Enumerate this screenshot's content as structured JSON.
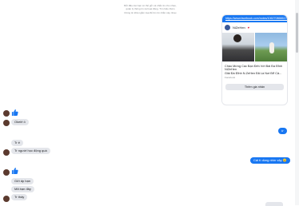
{
  "notice": {
    "line1": "Bởi đầu các bạn có thể gửi và nhắn tin cho nhau,",
    "line2": "quản lý thông tin và hoạt động. Tìm hiểu thêm",
    "line3": "thông tin khả ngắm loại để tìm tin nhắn này nhau"
  },
  "shared_post": {
    "link": "https://www.facebook.com/notes/1062708666170247/",
    "author": "NiZeHen",
    "title": "Chào Mừng Các Bạn Đến Với Bài Đa Đĩnh NiZeHen",
    "subtitle": "Giải Đá Đĩnh N.ZeHen Đã Là Nơi Để Cả...",
    "source": "Facebook",
    "button_label": "Thêm gia nhân"
  },
  "messages": {
    "received_1": "Okelê ô",
    "sent_1": "ừ",
    "received_2": "Tr ê",
    "received_3": "Tr người học động quá",
    "sent_2": "Cái tí dùng nhìn vậy 😊",
    "received_4": "Gửi ấp bạn",
    "received_5": "Mã bạn đây",
    "received_6": "Tr thấy"
  },
  "colors": {
    "brand_blue": "#1877f2",
    "bubble_gray": "#e4e6eb"
  }
}
